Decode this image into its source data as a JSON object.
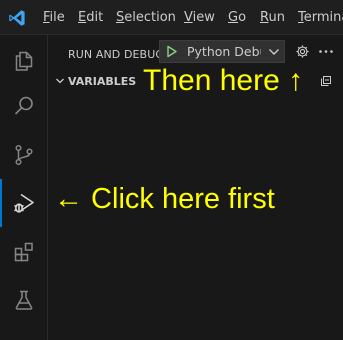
{
  "menu": {
    "items": [
      {
        "mnemonic": "F",
        "rest": "ile"
      },
      {
        "mnemonic": "E",
        "rest": "dit"
      },
      {
        "mnemonic": "S",
        "rest": "election"
      },
      {
        "mnemonic": "V",
        "rest": "iew"
      },
      {
        "mnemonic": "G",
        "rest": "o"
      },
      {
        "mnemonic": "R",
        "rest": "un"
      },
      {
        "mnemonic": "T",
        "rest": "ermina"
      }
    ]
  },
  "activity_bar": {
    "items": [
      {
        "icon": "explorer-files-icon",
        "active": false
      },
      {
        "icon": "search-icon",
        "active": false
      },
      {
        "icon": "source-control-icon",
        "active": false
      },
      {
        "icon": "run-and-debug-icon",
        "active": true
      },
      {
        "icon": "extensions-icon",
        "active": false
      },
      {
        "icon": "testing-flask-icon",
        "active": false
      }
    ]
  },
  "run_panel": {
    "title": "RUN AND DEBUG",
    "configuration": "Python Debugger",
    "section": "VARIABLES"
  },
  "annotations": {
    "then": "Then here ↑",
    "click": "← Click here first"
  },
  "colors": {
    "accent": "#0078d4",
    "play": "#89d185",
    "annotation": "#ffff00",
    "logo": "#3aa7f0"
  }
}
